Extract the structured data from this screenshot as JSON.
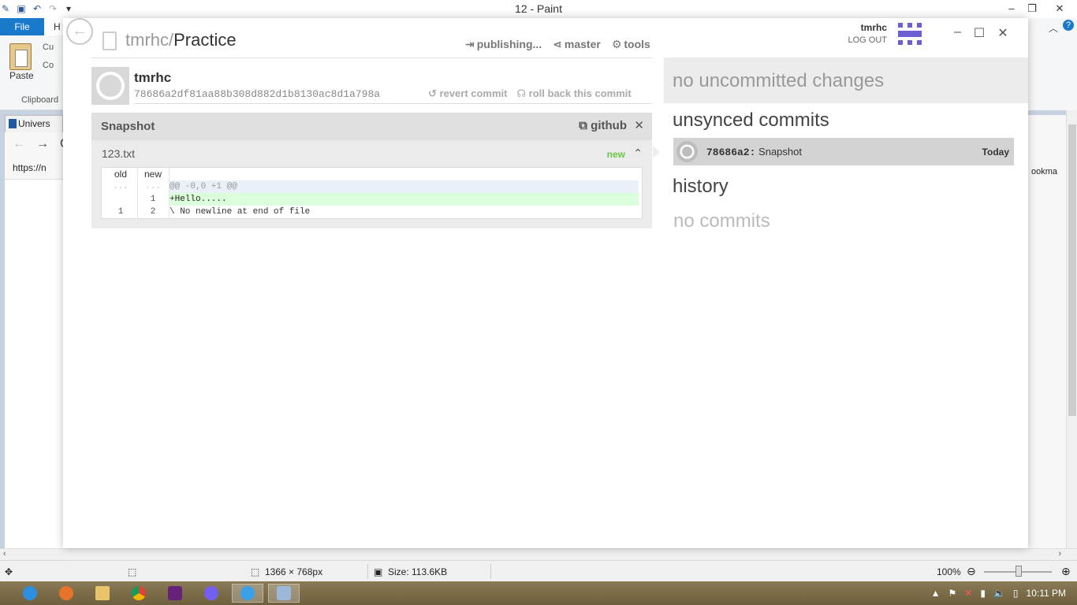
{
  "paint": {
    "window_title": "12 - Paint",
    "file_tab": "File",
    "home_tab_partial": "H",
    "cut_partial": "Cu",
    "copy_partial": "Co",
    "paste_label": "Paste",
    "clipboard_label": "Clipboard",
    "status": {
      "dimensions": "1366 × 768px",
      "size": "Size: 113.6KB",
      "zoom": "100%"
    }
  },
  "browser": {
    "tab_label": "Univers",
    "url_partial": "https://n",
    "bookmarks_partial": "ookma"
  },
  "github": {
    "repo_owner": "tmrhc/",
    "repo_name": "Practice",
    "toolbar": {
      "publishing": "publishing...",
      "branch": "master",
      "tools": "tools"
    },
    "user": {
      "name": "tmrhc",
      "logout": "LOG OUT"
    },
    "commit": {
      "author": "tmrhc",
      "sha": "78686a2df81aa88b308d882d1b8130ac8d1a798a",
      "revert": "revert commit",
      "rollback": "roll back this commit"
    },
    "snapshot": {
      "title": "Snapshot",
      "github_link": "github",
      "file": {
        "name": "123.txt",
        "status": "new",
        "headers": {
          "old": "old",
          "new": "new"
        },
        "rows": [
          {
            "old": "...",
            "new": "...",
            "text": "@@ -0,0 +1 @@"
          },
          {
            "old": "",
            "new": "1",
            "text": "+Hello....."
          },
          {
            "old": "1",
            "new": "2",
            "text": "\\ No newline at end of file"
          }
        ]
      }
    },
    "panel": {
      "changes": "no uncommitted changes",
      "unsynced_heading": "unsynced commits",
      "unsynced_item": {
        "sha": "78686a2:",
        "message": "Snapshot",
        "date": "Today"
      },
      "history_heading": "history",
      "no_commits": "no commits"
    }
  },
  "taskbar": {
    "clock": "10:11 PM"
  },
  "colors": {
    "accent_blue": "#1979ca",
    "diff_add_bg": "#dbffdb",
    "new_badge": "#6cc644",
    "avatar_purple": "#6b5fd3"
  }
}
